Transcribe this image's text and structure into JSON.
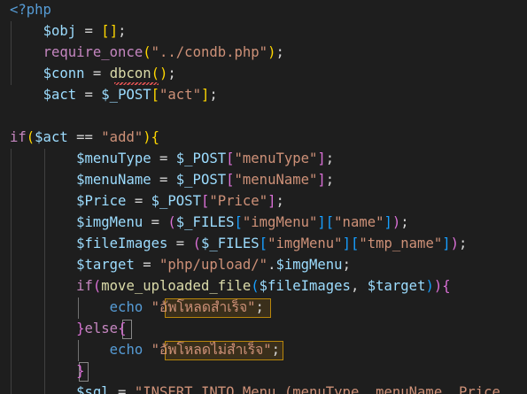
{
  "editor": {
    "language": "php",
    "theme": {
      "background": "#1e1e1e",
      "keyword": "#569cd6",
      "control": "#c586c0",
      "variable": "#9cdcfe",
      "function": "#dcdcaa",
      "string": "#ce9178",
      "bracket_level_1": "#ffd700",
      "bracket_level_2": "#da70d6",
      "bracket_level_3": "#179fff"
    },
    "lines": [
      [
        {
          "t": "<?php",
          "c": "tag"
        }
      ],
      [
        {
          "t": "    "
        },
        {
          "t": "$obj",
          "c": "var"
        },
        {
          "t": " = "
        },
        {
          "t": "[",
          "c": "b1"
        },
        {
          "t": "]",
          "c": "b1"
        },
        {
          "t": ";"
        }
      ],
      [
        {
          "t": "    "
        },
        {
          "t": "require_once",
          "c": "ctrl"
        },
        {
          "t": "(",
          "c": "b1"
        },
        {
          "t": "\"../condb.php\"",
          "c": "str"
        },
        {
          "t": ")",
          "c": "b1"
        },
        {
          "t": ";"
        }
      ],
      [
        {
          "t": "    "
        },
        {
          "t": "$conn",
          "c": "var"
        },
        {
          "t": " = "
        },
        {
          "t": "dbcon",
          "c": "fn"
        },
        {
          "t": "(",
          "c": "b1"
        },
        {
          "t": ")",
          "c": "b1"
        },
        {
          "t": ";"
        }
      ],
      [
        {
          "t": "    "
        },
        {
          "t": "$act",
          "c": "var"
        },
        {
          "t": " = "
        },
        {
          "t": "$_POST",
          "c": "var"
        },
        {
          "t": "[",
          "c": "b1"
        },
        {
          "t": "\"act\"",
          "c": "str"
        },
        {
          "t": "]",
          "c": "b1"
        },
        {
          "t": ";"
        }
      ],
      [],
      [
        {
          "t": "if",
          "c": "ctrl"
        },
        {
          "t": "(",
          "c": "b1"
        },
        {
          "t": "$act",
          "c": "var"
        },
        {
          "t": " == "
        },
        {
          "t": "\"add\"",
          "c": "str"
        },
        {
          "t": ")",
          "c": "b1"
        },
        {
          "t": "{",
          "c": "b1"
        }
      ],
      [
        {
          "t": "        "
        },
        {
          "t": "$menuType",
          "c": "var"
        },
        {
          "t": " = "
        },
        {
          "t": "$_POST",
          "c": "var"
        },
        {
          "t": "[",
          "c": "b2"
        },
        {
          "t": "\"menuType\"",
          "c": "str"
        },
        {
          "t": "]",
          "c": "b2"
        },
        {
          "t": ";"
        }
      ],
      [
        {
          "t": "        "
        },
        {
          "t": "$menuName",
          "c": "var"
        },
        {
          "t": " = "
        },
        {
          "t": "$_POST",
          "c": "var"
        },
        {
          "t": "[",
          "c": "b2"
        },
        {
          "t": "\"menuName\"",
          "c": "str"
        },
        {
          "t": "]",
          "c": "b2"
        },
        {
          "t": ";"
        }
      ],
      [
        {
          "t": "        "
        },
        {
          "t": "$Price",
          "c": "var"
        },
        {
          "t": " = "
        },
        {
          "t": "$_POST",
          "c": "var"
        },
        {
          "t": "[",
          "c": "b2"
        },
        {
          "t": "\"Price\"",
          "c": "str"
        },
        {
          "t": "]",
          "c": "b2"
        },
        {
          "t": ";"
        }
      ],
      [
        {
          "t": "        "
        },
        {
          "t": "$imgMenu",
          "c": "var"
        },
        {
          "t": " = "
        },
        {
          "t": "(",
          "c": "b2"
        },
        {
          "t": "$_FILES",
          "c": "var"
        },
        {
          "t": "[",
          "c": "b3"
        },
        {
          "t": "\"imgMenu\"",
          "c": "str"
        },
        {
          "t": "]",
          "c": "b3"
        },
        {
          "t": "[",
          "c": "b3"
        },
        {
          "t": "\"name\"",
          "c": "str"
        },
        {
          "t": "]",
          "c": "b3"
        },
        {
          "t": ")",
          "c": "b2"
        },
        {
          "t": ";"
        }
      ],
      [
        {
          "t": "        "
        },
        {
          "t": "$fileImages",
          "c": "var"
        },
        {
          "t": " = "
        },
        {
          "t": "(",
          "c": "b2"
        },
        {
          "t": "$_FILES",
          "c": "var"
        },
        {
          "t": "[",
          "c": "b3"
        },
        {
          "t": "\"imgMenu\"",
          "c": "str"
        },
        {
          "t": "]",
          "c": "b3"
        },
        {
          "t": "[",
          "c": "b3"
        },
        {
          "t": "\"tmp_name\"",
          "c": "str"
        },
        {
          "t": "]",
          "c": "b3"
        },
        {
          "t": ")",
          "c": "b2"
        },
        {
          "t": ";"
        }
      ],
      [
        {
          "t": "        "
        },
        {
          "t": "$target",
          "c": "var"
        },
        {
          "t": " = "
        },
        {
          "t": "\"php/upload/\"",
          "c": "str"
        },
        {
          "t": "."
        },
        {
          "t": "$imgMenu",
          "c": "var"
        },
        {
          "t": ";"
        }
      ],
      [
        {
          "t": "        "
        },
        {
          "t": "if",
          "c": "ctrl"
        },
        {
          "t": "(",
          "c": "b2"
        },
        {
          "t": "move_uploaded_file",
          "c": "fn"
        },
        {
          "t": "(",
          "c": "b3"
        },
        {
          "t": "$fileImages",
          "c": "var"
        },
        {
          "t": ", "
        },
        {
          "t": "$target",
          "c": "var"
        },
        {
          "t": ")",
          "c": "b3"
        },
        {
          "t": ")",
          "c": "b2"
        },
        {
          "t": "{",
          "c": "b2"
        }
      ],
      [
        {
          "t": "            "
        },
        {
          "t": "echo",
          "c": "kw"
        },
        {
          "t": " "
        },
        {
          "t": "\"อัพโหลดสำเร็จ\"",
          "c": "str"
        },
        {
          "t": ";"
        }
      ],
      [
        {
          "t": "        "
        },
        {
          "t": "}",
          "c": "b2"
        },
        {
          "t": "else",
          "c": "ctrl"
        },
        {
          "t": "{",
          "c": "b2"
        }
      ],
      [
        {
          "t": "            "
        },
        {
          "t": "echo",
          "c": "kw"
        },
        {
          "t": " "
        },
        {
          "t": "\"อัพโหลดไม่สำเร็จ\"",
          "c": "str"
        },
        {
          "t": ";"
        }
      ],
      [
        {
          "t": "        "
        },
        {
          "t": "}",
          "c": "b2"
        }
      ],
      [
        {
          "t": "        "
        },
        {
          "t": "$sql",
          "c": "var"
        },
        {
          "t": " = "
        },
        {
          "t": "\"INSERT INTO Menu (menuType, menuName, Price",
          "c": "str"
        }
      ]
    ]
  }
}
